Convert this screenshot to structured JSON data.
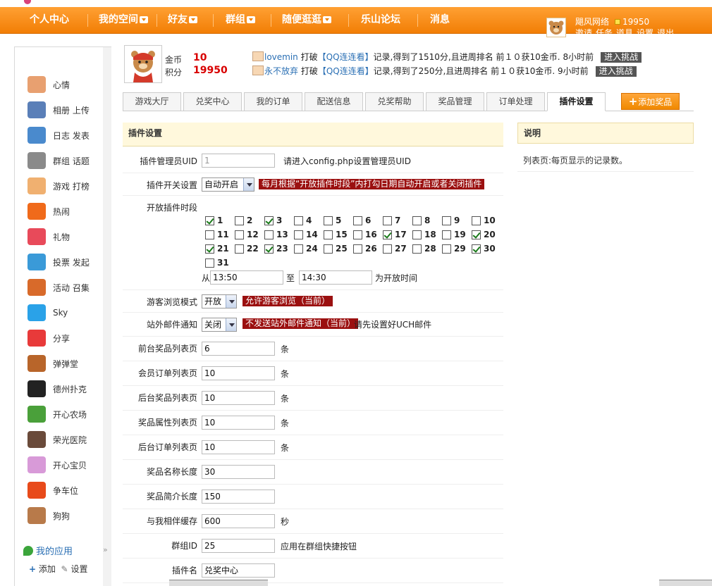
{
  "nav": {
    "items": [
      {
        "label": "个人中心",
        "dropdown": false
      },
      {
        "label": "我的空间",
        "dropdown": true
      },
      {
        "label": "好友",
        "dropdown": true
      },
      {
        "label": "群组",
        "dropdown": true
      },
      {
        "label": "随便逛逛",
        "dropdown": true
      },
      {
        "label": "乐山论坛",
        "dropdown": false
      },
      {
        "label": "消息",
        "dropdown": false
      }
    ],
    "username": "飓风网络",
    "coins": "19950",
    "links": [
      "邀请",
      "任务",
      "道具",
      "设置",
      "退出"
    ]
  },
  "sidebar": {
    "items": [
      {
        "label": "心情",
        "icon": "mood-icon",
        "color": "#e8a070"
      },
      {
        "label": "相册  上传",
        "icon": "album-icon",
        "color": "#5a7fb8"
      },
      {
        "label": "日志  发表",
        "icon": "blog-icon",
        "color": "#4a8acd"
      },
      {
        "label": "群组  话题",
        "icon": "group-icon",
        "color": "#8a8a8a"
      },
      {
        "label": "游戏  打榜",
        "icon": "game-icon",
        "color": "#f0b070"
      },
      {
        "label": "热闹",
        "icon": "hot-icon",
        "color": "#f06a1a"
      },
      {
        "label": "礼物",
        "icon": "gift-icon",
        "color": "#e84a5a"
      },
      {
        "label": "投票  发起",
        "icon": "poll-icon",
        "color": "#3a9ad8"
      },
      {
        "label": "活动  召集",
        "icon": "event-icon",
        "color": "#d86a2a"
      },
      {
        "label": "Sky",
        "icon": "sky-icon",
        "color": "#2aa2e8"
      },
      {
        "label": "分享",
        "icon": "share-icon",
        "color": "#e83a3a"
      },
      {
        "label": "弹弹堂",
        "icon": "ddt-icon",
        "color": "#b8652a"
      },
      {
        "label": "德州扑克",
        "icon": "poker-icon",
        "color": "#222222"
      },
      {
        "label": "开心农场",
        "icon": "farm-icon",
        "color": "#4aa03a"
      },
      {
        "label": "荣光医院",
        "icon": "hospital-icon",
        "color": "#6a4a3a"
      },
      {
        "label": "开心宝贝",
        "icon": "baby-icon",
        "color": "#d89ad8"
      },
      {
        "label": "争车位",
        "icon": "car-icon",
        "color": "#e84a1a"
      },
      {
        "label": "狗狗",
        "icon": "dog-icon",
        "color": "#b87a4a"
      }
    ],
    "my_apps": "我的应用",
    "add": "添加",
    "settings": "设置"
  },
  "profile": {
    "coins_label": "金币",
    "coins_value": "10",
    "points_label": "积分",
    "points_value": "19950"
  },
  "feed": [
    {
      "user": "lovemin",
      "action": "打破",
      "game": "【QQ连连看】",
      "text": "记录,得到了1510分,且进周排名 前１０获10金币.",
      "time": "8小时前",
      "button": "进入挑战"
    },
    {
      "user": "永不放弃",
      "action": "打破",
      "game": "【QQ连连看】",
      "text": "记录,得到了250分,且进周排名 前１０获10金币.",
      "time": "9小时前",
      "button": "进入挑战"
    }
  ],
  "tabs": [
    "游戏大厅",
    "兑奖中心",
    "我的订单",
    "配送信息",
    "兑奖帮助",
    "奖品管理",
    "订单处理",
    "插件设置"
  ],
  "active_tab": "插件设置",
  "add_prize": "添加奖品",
  "main_title": "插件设置",
  "help": {
    "title": "说明",
    "text": "列表页:每页显示的记录数。"
  },
  "form": {
    "admin_uid": {
      "label": "插件管理员UID",
      "value": "1",
      "note": "请进入config.php设置管理员UID"
    },
    "switch": {
      "label": "插件开关设置",
      "value": "自动开启",
      "note": "每月根据“开放插件时段”内打勾日期自动开启或者关闭插件"
    },
    "schedule": {
      "label": "开放插件时段",
      "days": [
        "1",
        "2",
        "3",
        "4",
        "5",
        "6",
        "7",
        "8",
        "9",
        "10",
        "11",
        "12",
        "13",
        "14",
        "15",
        "16",
        "17",
        "18",
        "19",
        "20",
        "21",
        "22",
        "23",
        "24",
        "25",
        "26",
        "27",
        "28",
        "29",
        "30",
        "31"
      ],
      "checked": [
        1,
        3,
        17,
        20,
        21,
        23,
        30
      ],
      "from_label": "从",
      "from": "13:50",
      "to_label": "至",
      "to": "14:30",
      "suffix": "为开放时间"
    },
    "guest": {
      "label": "游客浏览模式",
      "value": "开放",
      "note": "允许游客浏览（当前）"
    },
    "mail": {
      "label": "站外邮件通知",
      "value": "关闭",
      "note": "不发送站外邮件通知（当前）",
      "note2": "请先设置好UCH邮件"
    },
    "fields": [
      {
        "label": "前台奖品列表页",
        "value": "6",
        "unit": "条"
      },
      {
        "label": "会员订单列表页",
        "value": "10",
        "unit": "条"
      },
      {
        "label": "后台奖品列表页",
        "value": "10",
        "unit": "条"
      },
      {
        "label": "奖品属性列表页",
        "value": "10",
        "unit": "条"
      },
      {
        "label": "后台订单列表页",
        "value": "10",
        "unit": "条"
      },
      {
        "label": "奖品名称长度",
        "value": "30",
        "unit": ""
      },
      {
        "label": "奖品简介长度",
        "value": "150",
        "unit": ""
      },
      {
        "label": "与我相伴缓存",
        "value": "600",
        "unit": "秒"
      },
      {
        "label": "群组ID",
        "value": "25",
        "unit": "应用在群组快捷按钮"
      },
      {
        "label": "插件名",
        "value": "兑奖中心",
        "unit": ""
      }
    ]
  }
}
